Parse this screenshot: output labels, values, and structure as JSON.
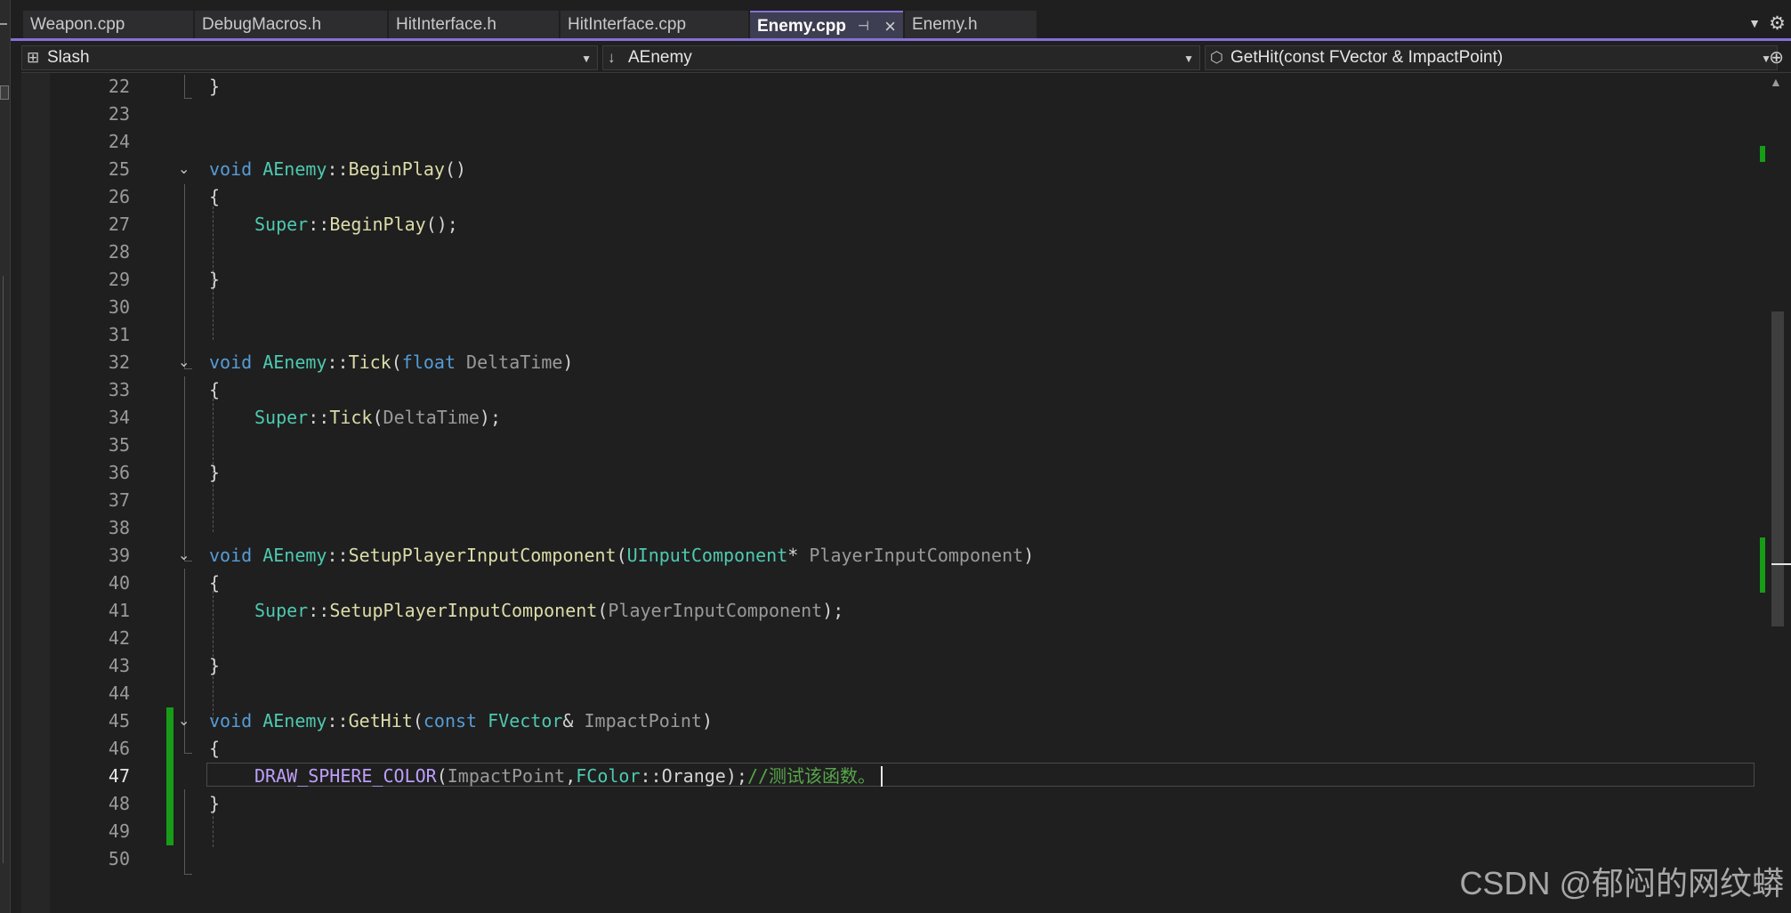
{
  "tabs": [
    {
      "label": "Weapon.cpp",
      "active": false
    },
    {
      "label": "DebugMacros.h",
      "active": false
    },
    {
      "label": "HitInterface.h",
      "active": false
    },
    {
      "label": "HitInterface.cpp",
      "active": false
    },
    {
      "label": "Enemy.cpp",
      "active": true
    },
    {
      "label": "Enemy.h",
      "active": false
    }
  ],
  "tab_icons": {
    "pin": "pin-icon",
    "close": "close-icon",
    "overflow": "chevron-down-icon",
    "settings": "gear-icon"
  },
  "nav": {
    "project": "Slash",
    "scope": "AEnemy",
    "member": "GetHit(const FVector & ImpactPoint)"
  },
  "editor": {
    "current_line": 47,
    "lines": [
      {
        "num": "22"
      },
      {
        "num": "23"
      },
      {
        "num": "24"
      },
      {
        "num": "25"
      },
      {
        "num": "26"
      },
      {
        "num": "27"
      },
      {
        "num": "28"
      },
      {
        "num": "29"
      },
      {
        "num": "30"
      },
      {
        "num": "31"
      },
      {
        "num": "32"
      },
      {
        "num": "33"
      },
      {
        "num": "34"
      },
      {
        "num": "35"
      },
      {
        "num": "36"
      },
      {
        "num": "37"
      },
      {
        "num": "38"
      },
      {
        "num": "39"
      },
      {
        "num": "40"
      },
      {
        "num": "41"
      },
      {
        "num": "42"
      },
      {
        "num": "43"
      },
      {
        "num": "44"
      },
      {
        "num": "45"
      },
      {
        "num": "46"
      },
      {
        "num": "47"
      },
      {
        "num": "48"
      },
      {
        "num": "49"
      },
      {
        "num": "50"
      }
    ],
    "code": {
      "l22": "}",
      "l25": {
        "void": "void",
        "cls": "AEnemy",
        "sep": "::",
        "fn": "BeginPlay",
        "rest": "()"
      },
      "l26": "{",
      "l27": {
        "cls": "Super",
        "sep": "::",
        "fn": "BeginPlay",
        "rest": "();"
      },
      "l29": "}",
      "l32": {
        "void": "void",
        "cls": "AEnemy",
        "sep": "::",
        "fn": "Tick",
        "open": "(",
        "type": "float",
        "param": "DeltaTime",
        "close": ")"
      },
      "l33": "{",
      "l34": {
        "cls": "Super",
        "sep": "::",
        "fn": "Tick",
        "open": "(",
        "param": "DeltaTime",
        "close": ");"
      },
      "l36": "}",
      "l39": {
        "void": "void",
        "cls": "AEnemy",
        "sep": "::",
        "fn": "SetupPlayerInputComponent",
        "open": "(",
        "type": "UInputComponent",
        "ptr": "* ",
        "param": "PlayerInputComponent",
        "close": ")"
      },
      "l40": "{",
      "l41": {
        "cls": "Super",
        "sep": "::",
        "fn": "SetupPlayerInputComponent",
        "open": "(",
        "param": "PlayerInputComponent",
        "close": ");"
      },
      "l43": "}",
      "l45": {
        "void": "void",
        "cls": "AEnemy",
        "sep": "::",
        "fn": "GetHit",
        "open": "(",
        "kw": "const",
        "type": "FVector",
        "ref": "& ",
        "param": "ImpactPoint",
        "close": ")"
      },
      "l46": "{",
      "l47": {
        "macro": "DRAW_SPHERE_COLOR",
        "open": "(",
        "param": "ImpactPoint",
        "comma": ",",
        "cls": "FColor",
        "sep": "::",
        "member": "Orange",
        "close": ");",
        "comment": "//测试该函数。"
      },
      "l48": "}"
    }
  },
  "watermark": "CSDN @郁闷的网纹蟒",
  "colors": {
    "background": "#1f1f1f",
    "keyword": "#569cd6",
    "class": "#4ec9b0",
    "function": "#dcdcaa",
    "macro": "#bd9ff9",
    "comment": "#57a64a",
    "change_marker": "#179c17",
    "tab_accent": "#8571d6"
  }
}
